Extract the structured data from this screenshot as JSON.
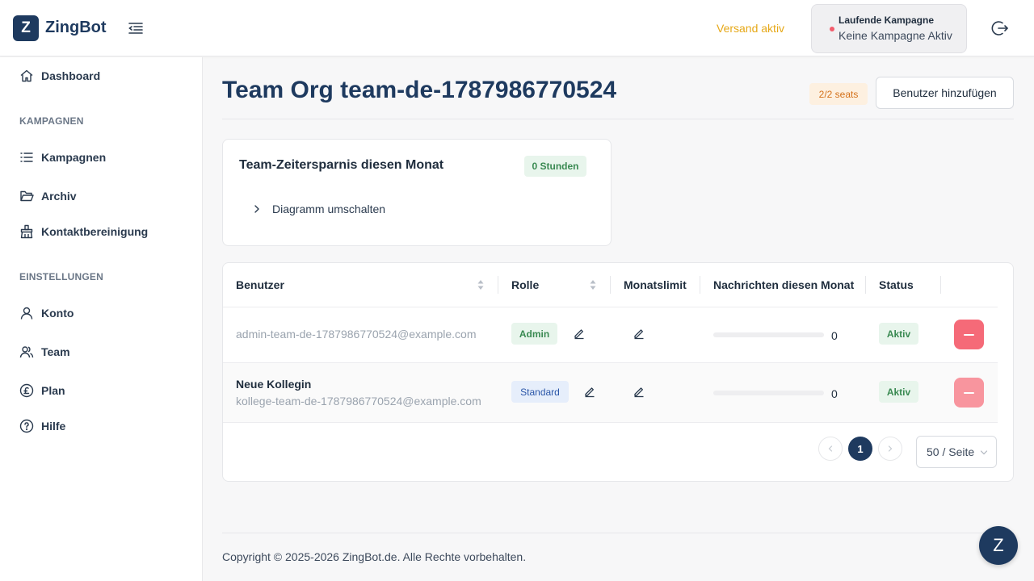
{
  "app": {
    "logo_letter": "Z",
    "name": "ZingBot"
  },
  "header": {
    "sending_status": "Versand aktiv",
    "campaign_label": "Laufende Kampagne",
    "campaign_value": "Keine Kampagne Aktiv"
  },
  "sidebar": {
    "items": [
      {
        "label": "Dashboard",
        "icon": "home-icon"
      },
      {
        "label": "Kampagnen",
        "icon": "list-icon"
      },
      {
        "label": "Archiv",
        "icon": "folder-open-icon"
      },
      {
        "label": "Kontaktbereinigung",
        "icon": "cleanup-icon"
      },
      {
        "label": "Konto",
        "icon": "user-icon"
      },
      {
        "label": "Team",
        "icon": "team-icon"
      },
      {
        "label": "Plan",
        "icon": "pound-icon"
      },
      {
        "label": "Hilfe",
        "icon": "help-icon"
      }
    ],
    "sections": {
      "campaigns": "KAMPAGNEN",
      "settings": "EINSTELLUNGEN"
    }
  },
  "main": {
    "title": "Team Org team-de-1787986770524",
    "seats": "2/2 seats",
    "add_user_label": "Benutzer hinzufügen"
  },
  "time_savings": {
    "title": "Team-Zeitersparnis diesen Monat",
    "badge": "0 Stunden",
    "toggle_label": "Diagramm umschalten"
  },
  "table": {
    "headers": {
      "user": "Benutzer",
      "role": "Rolle",
      "limit": "Monatslimit",
      "messages": "Nachrichten diesen Monat",
      "status": "Status"
    },
    "rows": [
      {
        "name": "",
        "email": "admin-team-de-1787986770524@example.com",
        "role": "Admin",
        "messages": "0",
        "usage": 0,
        "status": "Aktiv"
      },
      {
        "name": "Neue Kollegin",
        "email": "kollege-team-de-1787986770524@example.com",
        "role": "Standard",
        "messages": "0",
        "usage": 0,
        "status": "Aktiv"
      }
    ]
  },
  "pagination": {
    "current_page": "1",
    "page_size": "50 / Seite"
  },
  "footer": {
    "copyright": "Copyright © 2025-2026 ZingBot.de. Alle Rechte vorbehalten."
  },
  "chat": {
    "label": "Z"
  },
  "colors": {
    "brand": "#1e3a5f",
    "warning": "#e6a817",
    "danger": "#f25c6c",
    "success": "#3a8a52"
  }
}
